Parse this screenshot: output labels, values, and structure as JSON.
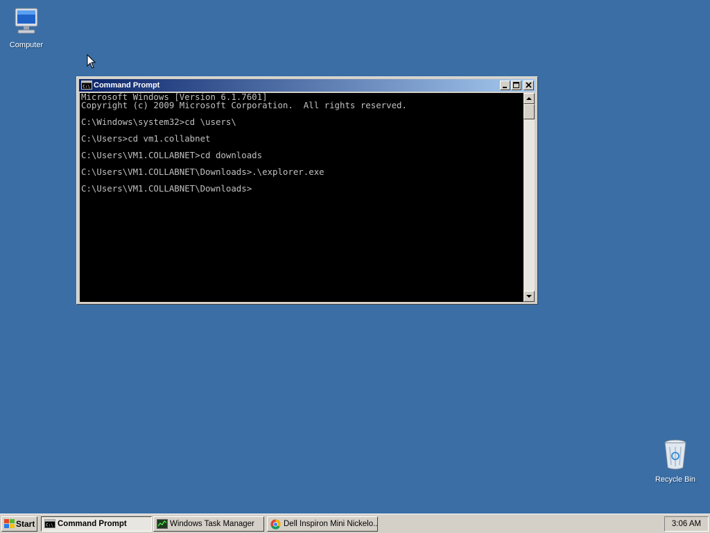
{
  "desktop": {
    "icons": [
      {
        "label": "Computer",
        "icon": "computer-icon"
      },
      {
        "label": "Recycle Bin",
        "icon": "recycle-bin-icon"
      }
    ],
    "background_color": "#3a6ea5"
  },
  "window": {
    "title": "Command Prompt",
    "icon": "cmd-icon",
    "console_lines": [
      "Microsoft Windows [Version 6.1.7601]",
      "Copyright (c) 2009 Microsoft Corporation.  All rights reserved.",
      "",
      "C:\\Windows\\system32>cd \\users\\",
      "",
      "C:\\Users>cd vm1.collabnet",
      "",
      "C:\\Users\\VM1.COLLABNET>cd downloads",
      "",
      "C:\\Users\\VM1.COLLABNET\\Downloads>.\\explorer.exe",
      "",
      "C:\\Users\\VM1.COLLABNET\\Downloads>"
    ]
  },
  "taskbar": {
    "start_label": "Start",
    "tasks": [
      {
        "label": "Command Prompt",
        "icon": "cmd-icon",
        "active": true
      },
      {
        "label": "Windows Task Manager",
        "icon": "task-manager-icon",
        "active": false
      },
      {
        "label": "Dell Inspiron Mini Nickelo...",
        "icon": "chrome-icon",
        "active": false
      }
    ],
    "clock": "3:06 AM"
  }
}
